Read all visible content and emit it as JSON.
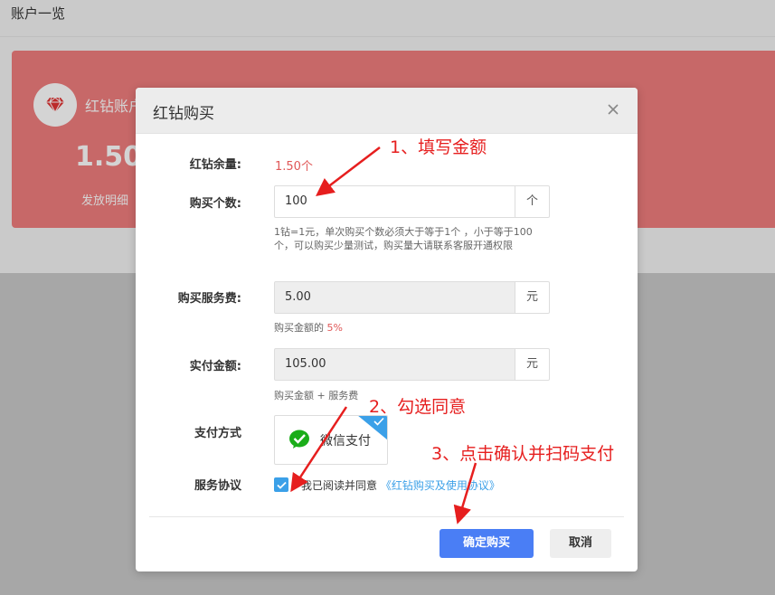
{
  "page": {
    "title": "账户一览",
    "card": {
      "title": "红钻账户",
      "balance": "1.50",
      "detail_link": "发放明细"
    }
  },
  "modal": {
    "title": "红钻购买",
    "close_icon": "close-icon",
    "balance": {
      "label": "红钻余量:",
      "value": "1.50个"
    },
    "quantity": {
      "label": "购买个数:",
      "value": "100",
      "unit": "个",
      "help": "1钻=1元，单次购买个数必须大于等于1个 ，小于等于100个，可以购买少量测试，购买量大请联系客服开通权限"
    },
    "service_fee": {
      "label": "购买服务费:",
      "value": "5.00",
      "unit": "元",
      "help_prefix": "购买金额的",
      "help_percent": "5%"
    },
    "actual": {
      "label": "实付金额:",
      "value": "105.00",
      "unit": "元",
      "help": "购买金额 + 服务费"
    },
    "payment": {
      "label": "支付方式",
      "option": "微信支付",
      "selected": true
    },
    "agreement": {
      "label": "服务协议",
      "checked": true,
      "text": "我已阅读并同意",
      "link": "《红钻购买及使用协议》"
    },
    "buttons": {
      "confirm": "确定购买",
      "cancel": "取消"
    }
  },
  "annotations": {
    "step1": "1、填写金额",
    "step2": "2、勾选同意",
    "step3": "3、点击确认并扫码支付"
  },
  "colors": {
    "card": "#f07d7d",
    "accent_red": "#e05757",
    "primary_blue": "#4a7ef5",
    "link_blue": "#3ba0e8",
    "annotation_red": "#e61e1e",
    "wechat_green": "#1aad19"
  }
}
